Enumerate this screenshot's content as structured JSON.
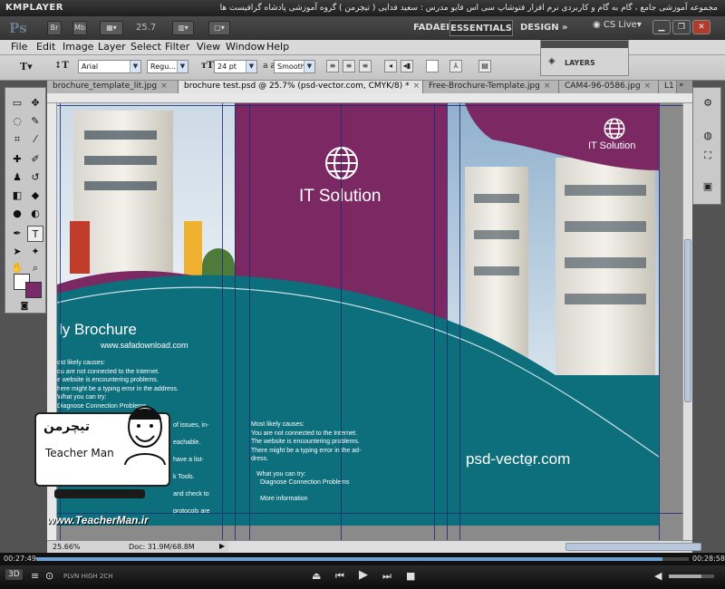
{
  "player": {
    "logo": "KMPLAYER",
    "caption": "مجموعه آموزشی جامع ، گام به گام و کاربردی نرم افزار فتوشاپ سی اس فایو  مدرس : سعید فدایی ( تیچرمن ) گروه آموزشی پادشاه گرافیست ها",
    "time_elapsed": "00:27:49",
    "time_total": "00:28:58",
    "progress": 0.96,
    "volume": 0.72,
    "badges": [
      "PLVN",
      "HIGH",
      "2CH"
    ]
  },
  "appbar": {
    "ps_logo": "Ps",
    "br": "Br",
    "mb": "Mb",
    "zoom": "25.7",
    "workspaces": [
      "FADAEI",
      "ESSENTIALS",
      "DESIGN"
    ],
    "active_workspace": "ESSENTIALS",
    "more": "»",
    "cs_live": "CS Live"
  },
  "menu": [
    "File",
    "Edit",
    "Image",
    "Layer",
    "Select",
    "Filter",
    "View",
    "Window",
    "Help"
  ],
  "layers_panel": {
    "label": "LAYERS"
  },
  "options": {
    "font_family": "Arial",
    "font_style": "Regu...",
    "font_size": "24 pt",
    "aa_label": "a a",
    "anti_alias": "Smooth"
  },
  "tabs": [
    {
      "label": "brochure_template_lit.jpg",
      "active": false
    },
    {
      "label": "brochure test.psd @ 25.7% (psd-vector.com, CMYK/8) *",
      "active": true
    },
    {
      "label": "Free-Brochure-Template.jpg",
      "active": false
    },
    {
      "label": "CAM4-96-0586.jpg",
      "active": false
    },
    {
      "label": "L1",
      "active": false
    }
  ],
  "status": {
    "zoom": "25.66%",
    "doc": "Doc: 31.9M/68.8M"
  },
  "brochure": {
    "panel_title": "IT Solution",
    "right_title": "IT Solution",
    "brochure_title": "ly Brochure",
    "url_small": "www.safadownload.com",
    "left_lines": [
      "ost likely causes:",
      "ou are not connected to the Internet.",
      "e website is encountering problems.",
      "here might be a typing error in the address.",
      "What you can try:",
      "Diagnose Connection Problems"
    ],
    "left_lines2": [
      "of issues, in-",
      "eachable.",
      "have a list-",
      "k Tools.",
      "and check to",
      "protocols are enabled"
    ],
    "middle_lines": [
      "Most likely causes:",
      "You are not connected to the Internet.",
      "The website is encountering problems.",
      "There might be a typing error in the ad-",
      "dress."
    ],
    "middle_try": "What you can try:",
    "middle_diag": "Diagnose Connection Problems",
    "middle_more": "More information",
    "big_url": "psd-vector.com"
  },
  "watermark": {
    "name": "Teacher Man",
    "persian": "تیچرمن",
    "url": "www.TeacherMan.ir"
  }
}
